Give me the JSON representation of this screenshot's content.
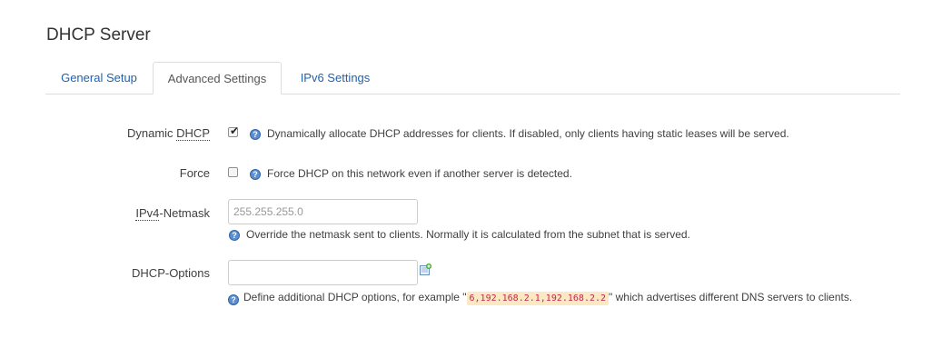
{
  "section": {
    "title": "DHCP Server"
  },
  "tabs": [
    {
      "label": "General Setup"
    },
    {
      "label": "Advanced Settings"
    },
    {
      "label": "IPv6 Settings"
    }
  ],
  "fields": {
    "dynamic_dhcp": {
      "label_prefix": "Dynamic ",
      "label_abbr": "DHCP",
      "checked": true,
      "description": "Dynamically allocate DHCP addresses for clients. If disabled, only clients having static leases will be served."
    },
    "force": {
      "label": "Force",
      "checked": false,
      "description": "Force DHCP on this network even if another server is detected."
    },
    "ipv4_netmask": {
      "label_abbr": "IPv4",
      "label_suffix": "-Netmask",
      "placeholder": "255.255.255.0",
      "value": "",
      "description": "Override the netmask sent to clients. Normally it is calculated from the subnet that is served."
    },
    "dhcp_options": {
      "label": "DHCP-Options",
      "value": "",
      "description_before": "Define additional DHCP options, for example \"",
      "example_code": "6,192.168.2.1,192.168.2.2",
      "description_after": "\" which advertises different DNS servers to clients."
    }
  },
  "icons": {
    "help": "help-icon",
    "add": "add-entry-icon"
  },
  "colors": {
    "link": "#1e62b0",
    "help_icon": "#5b8fd1",
    "code_background": "#fbe9c4"
  }
}
